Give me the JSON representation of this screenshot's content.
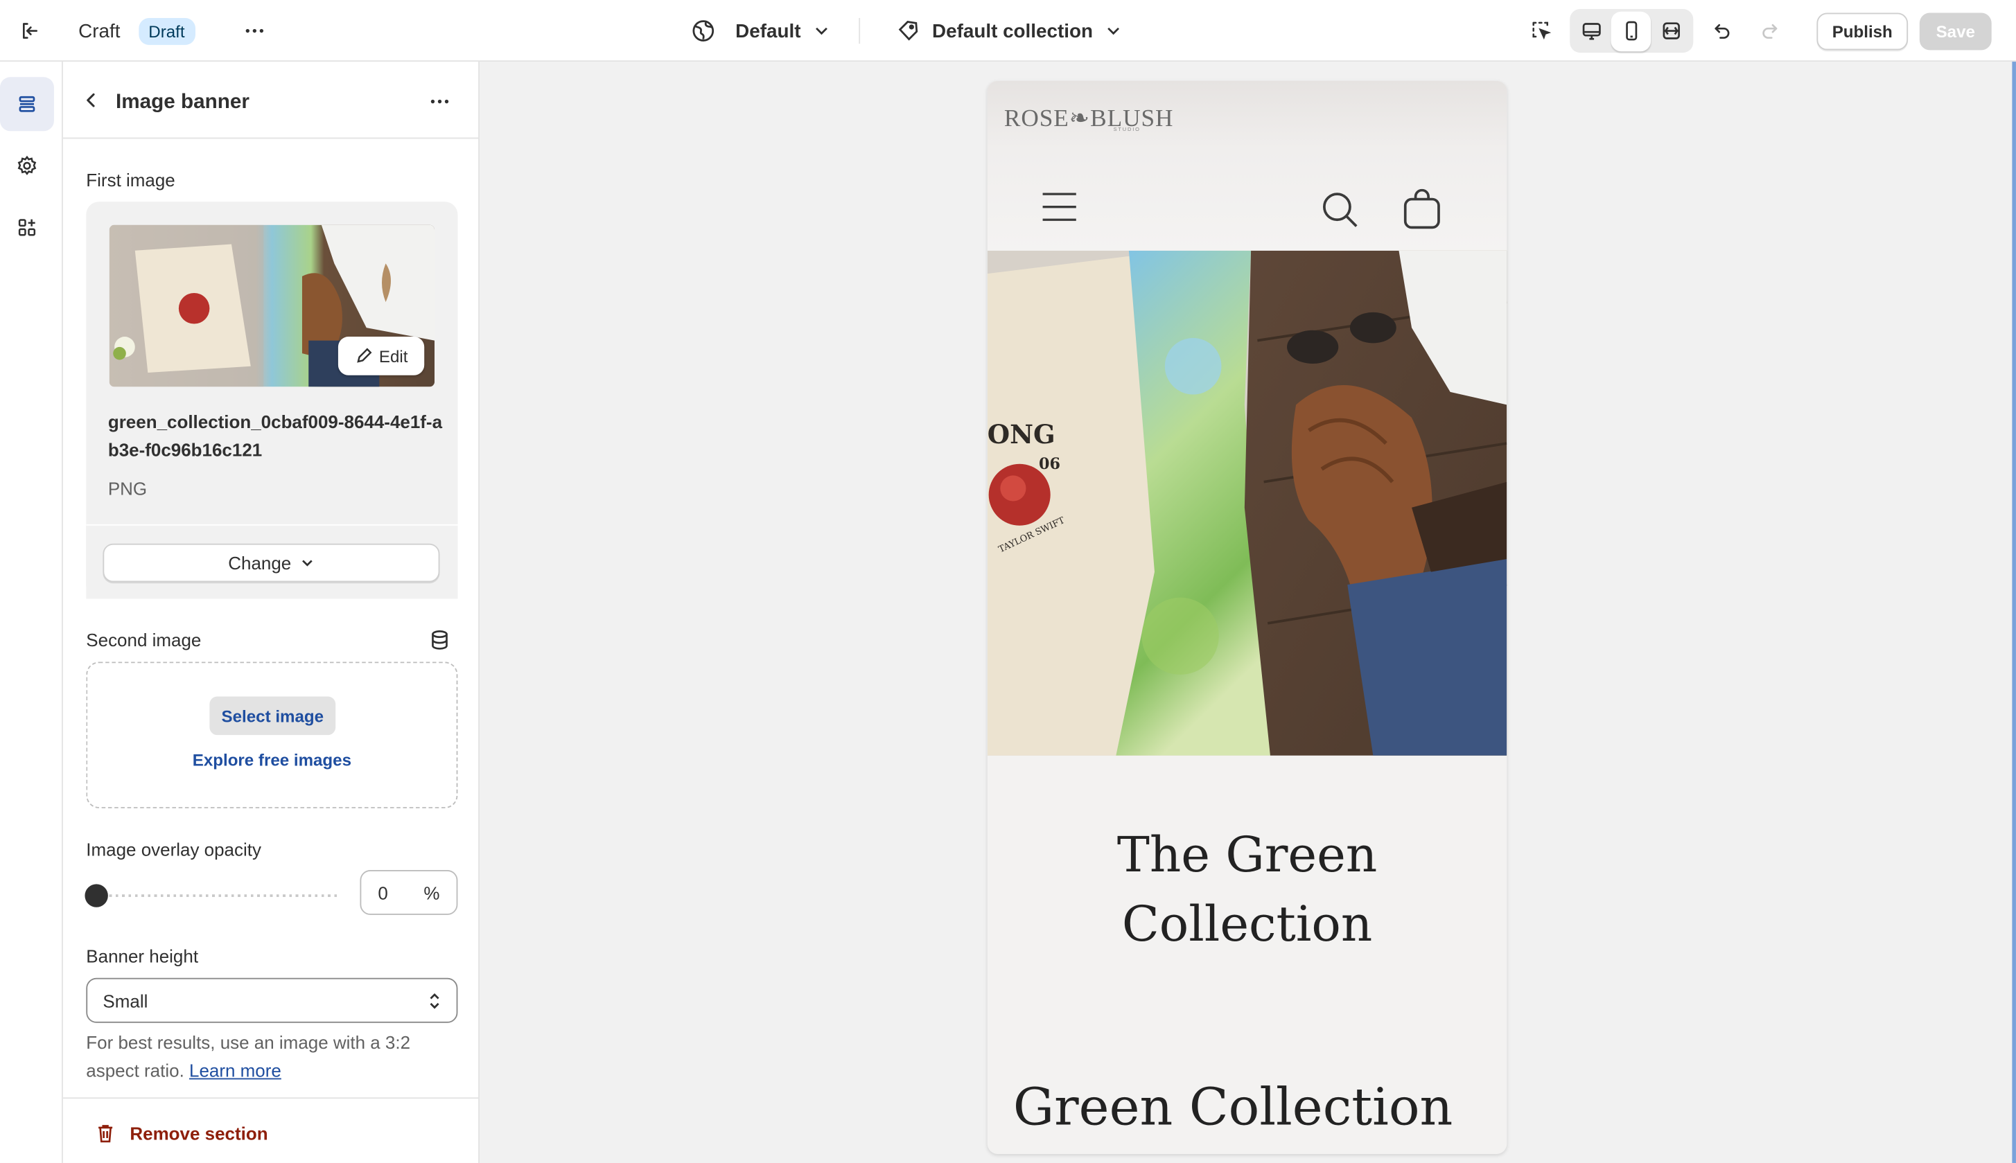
{
  "topbar": {
    "app_name": "Craft",
    "status_badge": "Draft",
    "theme_dropdown": "Default",
    "template_dropdown": "Default collection",
    "publish_label": "Publish",
    "save_label": "Save"
  },
  "rail": {
    "items": [
      "sections-icon",
      "settings-icon",
      "apps-icon"
    ],
    "active_item": "sections-icon"
  },
  "panel": {
    "title": "Image banner",
    "first_image": {
      "label": "First image",
      "filename": "green_collection_0cbaf009-8644-4e1f-ab3e-f0c96b16c121",
      "filetype": "PNG",
      "edit_label": "Edit",
      "change_label": "Change"
    },
    "second_image": {
      "label": "Second image",
      "select_label": "Select image",
      "explore_label": "Explore free images"
    },
    "overlay": {
      "label": "Image overlay opacity",
      "value": "0",
      "unit": "%"
    },
    "banner_height": {
      "label": "Banner height",
      "value": "Small"
    },
    "help": {
      "text": "For best results, use an image with a 3:2 aspect ratio.",
      "link": "Learn more"
    },
    "remove_label": "Remove section"
  },
  "preview": {
    "logo": "ROSE❧BLUSH",
    "logo_sub": "STUDIO",
    "banner_title_line1": "The Green",
    "banner_title_line2": "Collection",
    "section_heading": "Green Collection"
  },
  "colors": {
    "accent_blue": "#1f4ea0",
    "badge_bg": "#d5ebff",
    "critical": "#8e1f0b",
    "save_disabled": "#d4d4d4"
  }
}
